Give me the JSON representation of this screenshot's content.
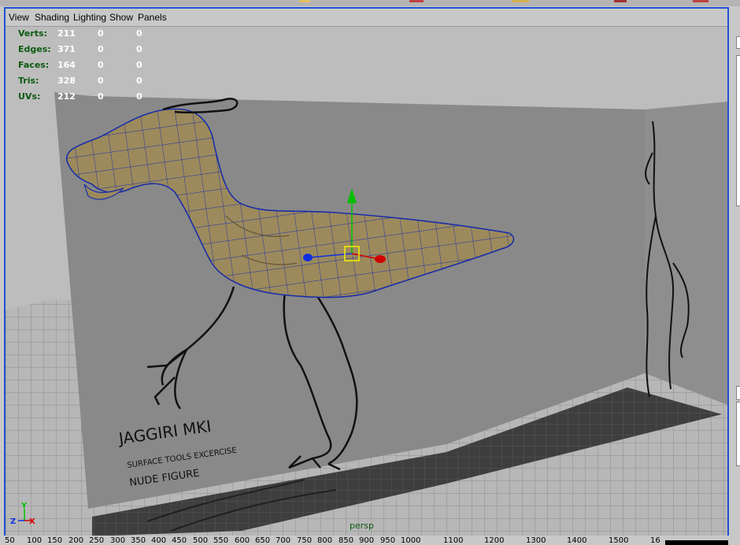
{
  "menu": {
    "view": "View",
    "shading": "Shading",
    "lighting": "Lighting",
    "show": "Show",
    "panels": "Panels"
  },
  "hud": {
    "rows": [
      {
        "label": "Verts:",
        "v1": "211",
        "v2": "0",
        "v3": "0"
      },
      {
        "label": "Edges:",
        "v1": "371",
        "v2": "0",
        "v3": "0"
      },
      {
        "label": "Faces:",
        "v1": "164",
        "v2": "0",
        "v3": "0"
      },
      {
        "label": "Tris:",
        "v1": "328",
        "v2": "0",
        "v3": "0"
      },
      {
        "label": "UVs:",
        "v1": "212",
        "v2": "0",
        "v3": "0"
      }
    ]
  },
  "reference_image": {
    "line1": "JAGGIRI MKI",
    "line2": "SURFACE TOOLS EXCERCISE",
    "line3": "NUDE FIGURE"
  },
  "axis_gizmo": {
    "y": "Y",
    "z": "Z",
    "x": "X"
  },
  "camera": "persp",
  "timeline": {
    "ticks": [
      "50",
      "100",
      "150",
      "200",
      "250",
      "300",
      "350",
      "400",
      "450",
      "500",
      "550",
      "600",
      "650",
      "700",
      "750",
      "800",
      "850",
      "900",
      "950",
      "1000",
      "1100",
      "1200",
      "1300",
      "1400",
      "1500",
      "16"
    ]
  },
  "colors": {
    "panel_border": "#1f51d6",
    "mesh_fill": "#9c8a5c",
    "mesh_wire": "#1a2ea8",
    "hud_label": "#0d5a10",
    "hud_value": "#ffffff",
    "manip_y": "#00c000",
    "manip_x": "#d00000",
    "manip_z": "#1030e0",
    "manip_center": "#f0f000"
  }
}
